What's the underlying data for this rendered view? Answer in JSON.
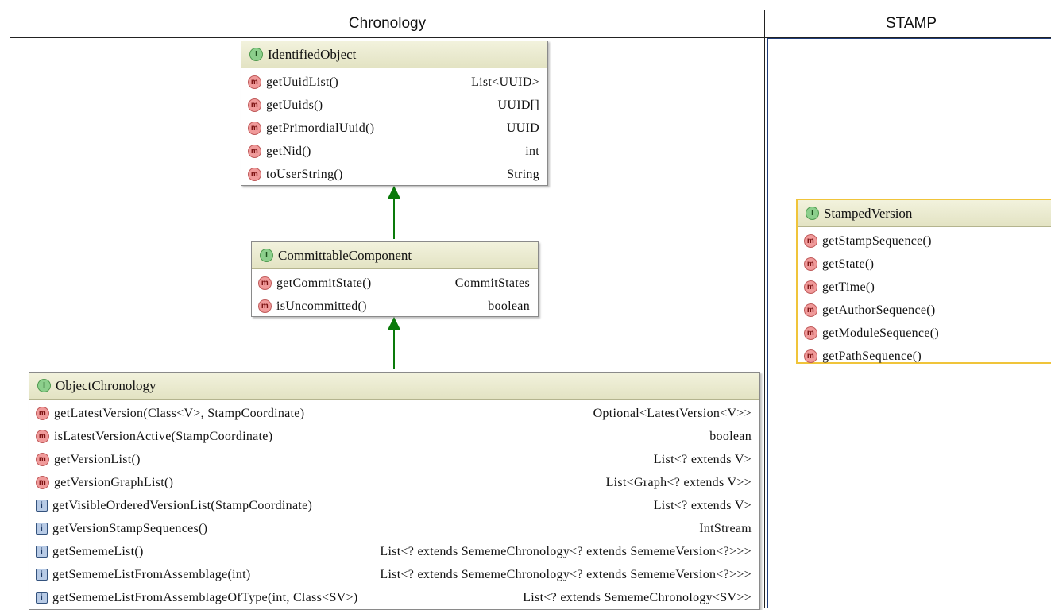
{
  "headers": {
    "left": "Chronology",
    "right": "STAMP"
  },
  "identified_object": {
    "name": "IdentifiedObject",
    "methods": [
      {
        "icon": "m",
        "name": "getUuidList()",
        "ret": "List<UUID>"
      },
      {
        "icon": "m",
        "name": "getUuids()",
        "ret": "UUID[]"
      },
      {
        "icon": "m",
        "name": "getPrimordialUuid()",
        "ret": "UUID"
      },
      {
        "icon": "m",
        "name": "getNid()",
        "ret": "int"
      },
      {
        "icon": "m",
        "name": "toUserString()",
        "ret": "String"
      }
    ]
  },
  "committable_component": {
    "name": "CommittableComponent",
    "methods": [
      {
        "icon": "m",
        "name": "getCommitState()",
        "ret": "CommitStates"
      },
      {
        "icon": "m",
        "name": "isUncommitted()",
        "ret": "boolean"
      }
    ]
  },
  "object_chronology": {
    "name": "ObjectChronology",
    "methods": [
      {
        "icon": "m",
        "name": "getLatestVersion(Class<V>, StampCoordinate)",
        "ret": "Optional<LatestVersion<V>>"
      },
      {
        "icon": "m",
        "name": "isLatestVersionActive(StampCoordinate)",
        "ret": "boolean"
      },
      {
        "icon": "m",
        "name": "getVersionList()",
        "ret": "List<? extends V>"
      },
      {
        "icon": "m",
        "name": "getVersionGraphList()",
        "ret": "List<Graph<? extends V>>"
      },
      {
        "icon": "i",
        "name": "getVisibleOrderedVersionList(StampCoordinate)",
        "ret": "List<? extends V>"
      },
      {
        "icon": "i",
        "name": "getVersionStampSequences()",
        "ret": "IntStream"
      },
      {
        "icon": "i",
        "name": "getSememeList()",
        "ret": "List<? extends SememeChronology<? extends SememeVersion<?>>>"
      },
      {
        "icon": "i",
        "name": "getSememeListFromAssemblage(int)",
        "ret": "List<? extends SememeChronology<? extends SememeVersion<?>>>"
      },
      {
        "icon": "i",
        "name": "getSememeListFromAssemblageOfType(int, Class<SV>)",
        "ret": "List<? extends SememeChronology<SV>>"
      }
    ]
  },
  "stamped_version": {
    "name": "StampedVersion",
    "methods": [
      {
        "icon": "m",
        "name": "getStampSequence()",
        "ret": ""
      },
      {
        "icon": "m",
        "name": "getState()",
        "ret": ""
      },
      {
        "icon": "m",
        "name": "getTime()",
        "ret": ""
      },
      {
        "icon": "m",
        "name": "getAuthorSequence()",
        "ret": ""
      },
      {
        "icon": "m",
        "name": "getModuleSequence()",
        "ret": ""
      },
      {
        "icon": "m",
        "name": "getPathSequence()",
        "ret": ""
      }
    ]
  },
  "colors": {
    "arrow": "#0a7a0a",
    "title_bg": "#e7e7cb",
    "highlight_border": "#f0c43a"
  }
}
